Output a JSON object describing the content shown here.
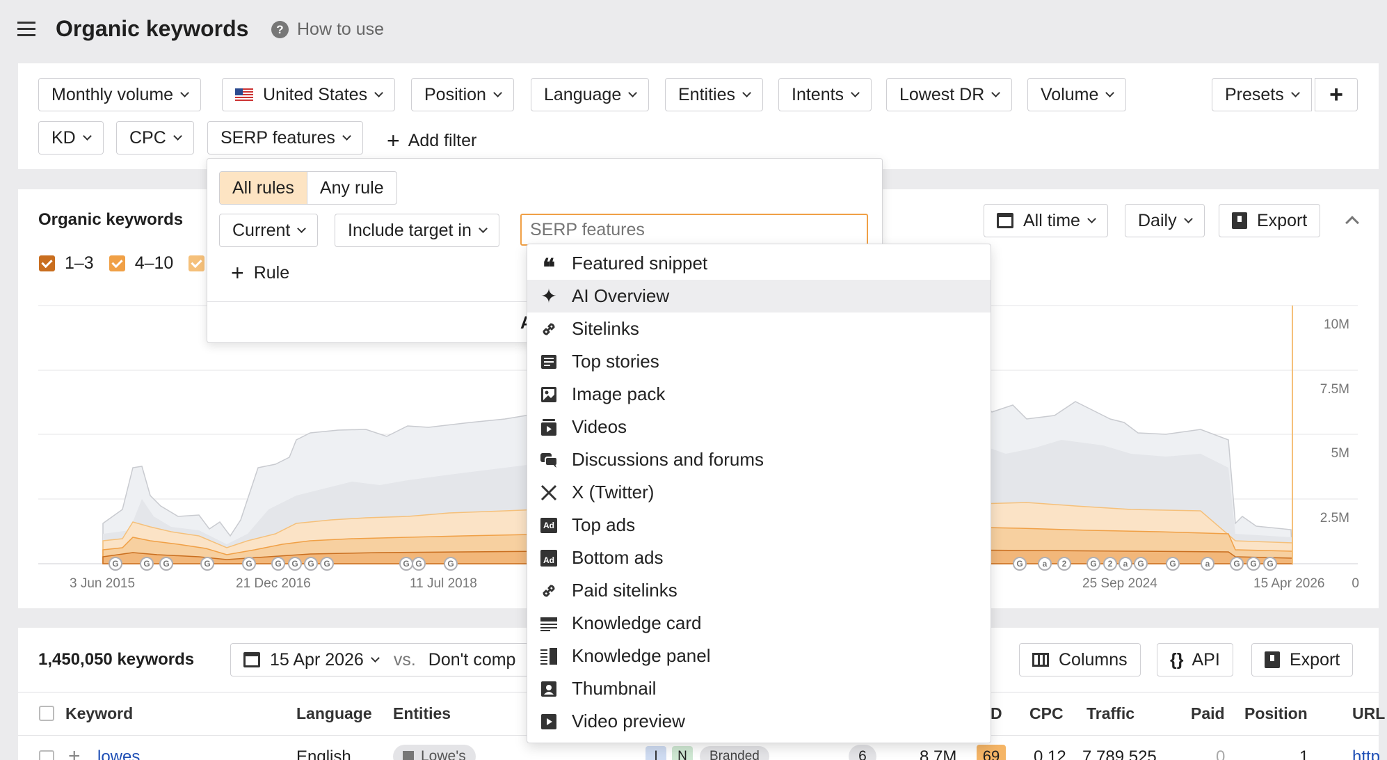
{
  "header": {
    "title": "Organic keywords",
    "help": "How to use"
  },
  "filters": {
    "row1": [
      "Monthly volume",
      "United States",
      "Position",
      "Language",
      "Entities",
      "Intents",
      "Lowest DR",
      "Volume"
    ],
    "row2": [
      "KD",
      "CPC",
      "SERP features"
    ],
    "add_filter": "Add filter",
    "presets": "Presets"
  },
  "serp_popup": {
    "all_rules": "All rules",
    "any_rule": "Any rule",
    "current": "Current",
    "include": "Include target in",
    "placeholder": "SERP features",
    "rule": "Rule",
    "apply_fragment": "A"
  },
  "dropdown": {
    "items": [
      {
        "label": "Featured snippet",
        "icon": "quote-icon"
      },
      {
        "label": "AI Overview",
        "icon": "sparkle-icon"
      },
      {
        "label": "Sitelinks",
        "icon": "link-icon"
      },
      {
        "label": "Top stories",
        "icon": "news-icon"
      },
      {
        "label": "Image pack",
        "icon": "images-icon"
      },
      {
        "label": "Videos",
        "icon": "videos-icon"
      },
      {
        "label": "Discussions and forums",
        "icon": "chat-icon"
      },
      {
        "label": "X (Twitter)",
        "icon": "x-icon"
      },
      {
        "label": "Top ads",
        "icon": "ad-icon"
      },
      {
        "label": "Bottom ads",
        "icon": "ad-bottom-icon"
      },
      {
        "label": "Paid sitelinks",
        "icon": "link-icon"
      },
      {
        "label": "Knowledge card",
        "icon": "card-icon"
      },
      {
        "label": "Knowledge panel",
        "icon": "panel-icon"
      },
      {
        "label": "Thumbnail",
        "icon": "thumbnail-icon"
      },
      {
        "label": "Video preview",
        "icon": "play-icon"
      }
    ]
  },
  "chart": {
    "title": "Organic keywords",
    "legend": [
      {
        "label": "1–3",
        "color": "#c96e1f"
      },
      {
        "label": "4–10",
        "color": "#f0a046"
      },
      {
        "label": "",
        "color": "#f5c07a"
      }
    ],
    "range": "All time",
    "interval": "Daily",
    "export": "Export"
  },
  "chart_data": {
    "type": "area",
    "x_ticks": [
      "3 Jun 2015",
      "21 Dec 2016",
      "11 Jul 2018",
      "25 Sep 2024",
      "15 Apr 2026"
    ],
    "y_ticks": [
      "10M",
      "7.5M",
      "5M",
      "2.5M",
      "0"
    ],
    "ylim": [
      0,
      10000000
    ],
    "grid": true,
    "legend_position": "top-left"
  },
  "table_bar": {
    "count": "1,450,050 keywords",
    "date": "15 Apr 2026",
    "vs": "vs.",
    "compare": "Don't comp",
    "columns": "Columns",
    "api": "API",
    "export": "Export"
  },
  "table": {
    "headers": [
      "Keyword",
      "Language",
      "Entities",
      "D",
      "CPC",
      "Traffic",
      "Paid",
      "Position",
      "URL"
    ],
    "row": {
      "keyword": "lowes",
      "language": "English",
      "entity": "Lowe's",
      "intent_i": "I",
      "intent_n": "N",
      "branded": "Branded",
      "col6": "6",
      "volume": "8.7M",
      "kd": "69",
      "cpc": "0.12",
      "traffic": "7,789,525",
      "paid": "0",
      "position": "1",
      "url": "http"
    }
  }
}
